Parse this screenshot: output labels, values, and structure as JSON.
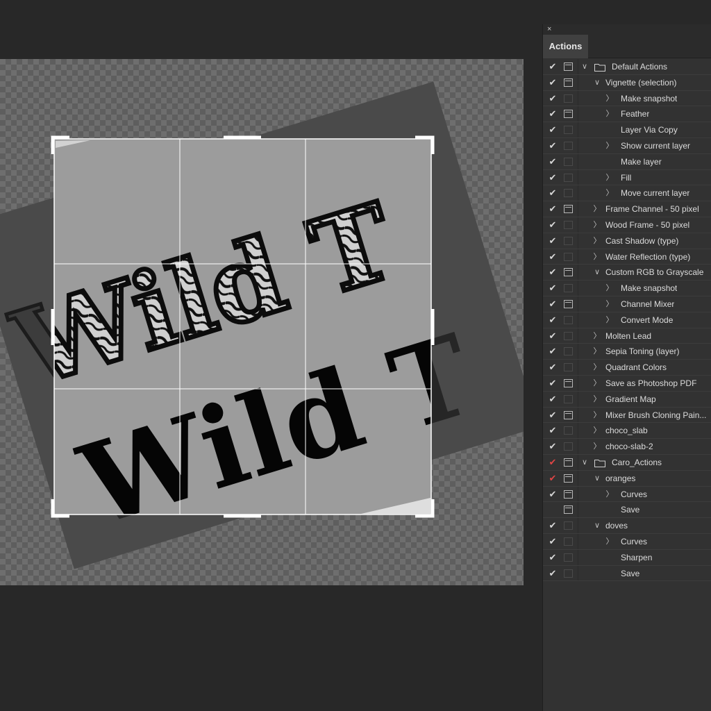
{
  "panel": {
    "close_glyph": "×",
    "tab_label": "Actions"
  },
  "canvas": {
    "text_line_1": "Wild T",
    "text_line_2": "Wild T"
  },
  "actions": [
    {
      "label": "Default Actions",
      "level": 0,
      "folder": true,
      "expanded": true,
      "checked": true,
      "dialog": true,
      "red": false
    },
    {
      "label": "Vignette (selection)",
      "level": 1,
      "folder": false,
      "expanded": true,
      "checked": true,
      "dialog": true,
      "red": false
    },
    {
      "label": "Make snapshot",
      "level": 2,
      "folder": false,
      "expanded": false,
      "checked": true,
      "dialog": false,
      "red": false
    },
    {
      "label": "Feather",
      "level": 2,
      "folder": false,
      "expanded": false,
      "checked": true,
      "dialog": true,
      "red": false
    },
    {
      "label": "Layer Via Copy",
      "level": 2,
      "folder": false,
      "expanded": null,
      "checked": true,
      "dialog": false,
      "red": false
    },
    {
      "label": "Show current layer",
      "level": 2,
      "folder": false,
      "expanded": false,
      "checked": true,
      "dialog": false,
      "red": false
    },
    {
      "label": "Make layer",
      "level": 2,
      "folder": false,
      "expanded": null,
      "checked": true,
      "dialog": false,
      "red": false
    },
    {
      "label": "Fill",
      "level": 2,
      "folder": false,
      "expanded": false,
      "checked": true,
      "dialog": false,
      "red": false
    },
    {
      "label": "Move current layer",
      "level": 2,
      "folder": false,
      "expanded": false,
      "checked": true,
      "dialog": false,
      "red": false
    },
    {
      "label": "Frame Channel - 50 pixel",
      "level": 1,
      "folder": false,
      "expanded": false,
      "checked": true,
      "dialog": true,
      "red": false
    },
    {
      "label": "Wood Frame - 50 pixel",
      "level": 1,
      "folder": false,
      "expanded": false,
      "checked": true,
      "dialog": false,
      "red": false
    },
    {
      "label": "Cast Shadow (type)",
      "level": 1,
      "folder": false,
      "expanded": false,
      "checked": true,
      "dialog": false,
      "red": false
    },
    {
      "label": "Water Reflection (type)",
      "level": 1,
      "folder": false,
      "expanded": false,
      "checked": true,
      "dialog": false,
      "red": false
    },
    {
      "label": "Custom RGB to Grayscale",
      "level": 1,
      "folder": false,
      "expanded": true,
      "checked": true,
      "dialog": true,
      "red": false
    },
    {
      "label": "Make snapshot",
      "level": 2,
      "folder": false,
      "expanded": false,
      "checked": true,
      "dialog": false,
      "red": false
    },
    {
      "label": "Channel Mixer",
      "level": 2,
      "folder": false,
      "expanded": false,
      "checked": true,
      "dialog": true,
      "red": false
    },
    {
      "label": "Convert Mode",
      "level": 2,
      "folder": false,
      "expanded": false,
      "checked": true,
      "dialog": false,
      "red": false
    },
    {
      "label": "Molten Lead",
      "level": 1,
      "folder": false,
      "expanded": false,
      "checked": true,
      "dialog": false,
      "red": false
    },
    {
      "label": "Sepia Toning (layer)",
      "level": 1,
      "folder": false,
      "expanded": false,
      "checked": true,
      "dialog": false,
      "red": false
    },
    {
      "label": "Quadrant Colors",
      "level": 1,
      "folder": false,
      "expanded": false,
      "checked": true,
      "dialog": false,
      "red": false
    },
    {
      "label": "Save as Photoshop PDF",
      "level": 1,
      "folder": false,
      "expanded": false,
      "checked": true,
      "dialog": true,
      "red": false
    },
    {
      "label": "Gradient Map",
      "level": 1,
      "folder": false,
      "expanded": false,
      "checked": true,
      "dialog": false,
      "red": false
    },
    {
      "label": "Mixer Brush Cloning Pain...",
      "level": 1,
      "folder": false,
      "expanded": false,
      "checked": true,
      "dialog": true,
      "red": false
    },
    {
      "label": "choco_slab",
      "level": 1,
      "folder": false,
      "expanded": false,
      "checked": true,
      "dialog": false,
      "red": false
    },
    {
      "label": "choco-slab-2",
      "level": 1,
      "folder": false,
      "expanded": false,
      "checked": true,
      "dialog": false,
      "red": false
    },
    {
      "label": "Caro_Actions",
      "level": 0,
      "folder": true,
      "expanded": true,
      "checked": true,
      "dialog": true,
      "red": true
    },
    {
      "label": "oranges",
      "level": 1,
      "folder": false,
      "expanded": true,
      "checked": true,
      "dialog": true,
      "red": true
    },
    {
      "label": "Curves",
      "level": 2,
      "folder": false,
      "expanded": false,
      "checked": true,
      "dialog": true,
      "red": false
    },
    {
      "label": "Save",
      "level": 2,
      "folder": false,
      "expanded": null,
      "checked": false,
      "dialog": true,
      "red": false
    },
    {
      "label": "doves",
      "level": 1,
      "folder": false,
      "expanded": true,
      "checked": true,
      "dialog": false,
      "red": false
    },
    {
      "label": "Curves",
      "level": 2,
      "folder": false,
      "expanded": false,
      "checked": true,
      "dialog": false,
      "red": false
    },
    {
      "label": "Sharpen",
      "level": 2,
      "folder": false,
      "expanded": null,
      "checked": true,
      "dialog": false,
      "red": false
    },
    {
      "label": "Save",
      "level": 2,
      "folder": false,
      "expanded": null,
      "checked": true,
      "dialog": false,
      "red": false
    }
  ]
}
